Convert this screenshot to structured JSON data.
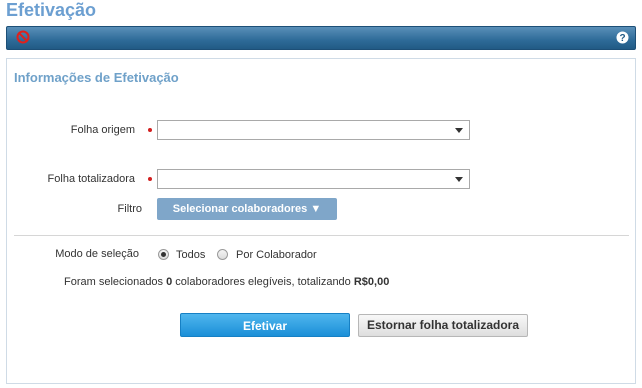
{
  "page": {
    "title": "Efetivação"
  },
  "toolbar": {
    "cancel_icon": "prohibited-icon",
    "help_icon": "help-icon"
  },
  "panel": {
    "title": "Informações de Efetivação"
  },
  "form": {
    "folha_origem": {
      "label": "Folha origem",
      "value": "",
      "required": true
    },
    "folha_totalizadora": {
      "label": "Folha totalizadora",
      "value": "",
      "required": true
    },
    "filtro": {
      "label": "Filtro",
      "button_label": "Selecionar colaboradores ▼"
    },
    "modo_selecao": {
      "label": "Modo de seleção",
      "options": [
        "Todos",
        "Por Colaborador"
      ],
      "selected": "Todos"
    },
    "summary": {
      "prefix": "Foram selecionados ",
      "count": "0",
      "middle": " colaboradores elegíveis, totalizando ",
      "total": "R$0,00"
    }
  },
  "actions": {
    "efetivar_label": "Efetivar",
    "estornar_label": "Estornar folha totalizadora"
  },
  "colors": {
    "accent": "#6c9fd1",
    "toolbar": "#2e6b98",
    "primary_button": "#1b8fd8",
    "required": "#d21f1f"
  }
}
